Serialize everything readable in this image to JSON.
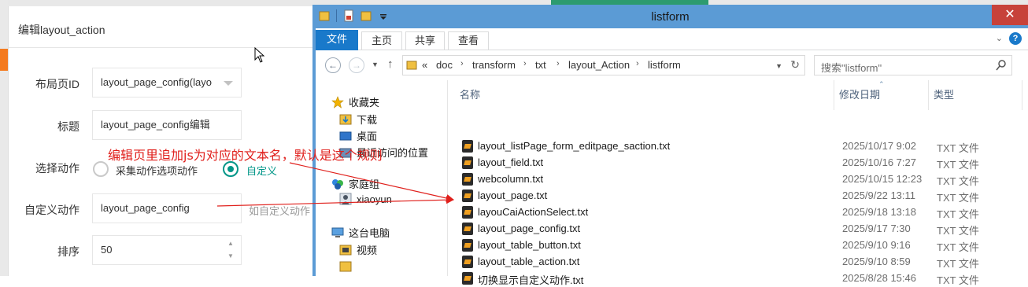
{
  "form": {
    "title": "编辑layout_action",
    "fields": [
      {
        "label": "布局页ID",
        "value": "layout_page_config(layo"
      },
      {
        "label": "标题",
        "value": "layout_page_config编辑"
      },
      {
        "label": "选择动作",
        "options": [
          "采集动作选项动作",
          "自定义"
        ],
        "selected": "自定义"
      },
      {
        "label": "自定义动作",
        "value": "layout_page_config",
        "hint": "如自定义动作"
      },
      {
        "label": "排序",
        "value": "50"
      }
    ]
  },
  "explorer": {
    "window_title": "listform",
    "ribbon_tabs": [
      "文件",
      "主页",
      "共享",
      "查看"
    ],
    "address": {
      "overflow": "«",
      "crumbs": [
        "doc",
        "transform",
        "txt",
        "layout_Action",
        "listform"
      ]
    },
    "search_placeholder": "搜索\"listform\"",
    "nav_pane": {
      "favorites": "收藏夹",
      "downloads": "下载",
      "desktop": "桌面",
      "recent": "最近访问的位置",
      "homegroup": "家庭组",
      "user": "xiaoyun",
      "this_pc": "这台电脑",
      "videos": "视频"
    },
    "columns": {
      "name": "名称",
      "date": "修改日期",
      "type": "类型"
    },
    "files": [
      {
        "name": "layout_listPage_form_editpage_saction.txt",
        "date": "2025/10/17 9:02",
        "type": "TXT 文件"
      },
      {
        "name": "layout_field.txt",
        "date": "2025/10/16 7:27",
        "type": "TXT 文件"
      },
      {
        "name": "webcolumn.txt",
        "date": "2025/10/15 12:23",
        "type": "TXT 文件"
      },
      {
        "name": "layout_page.txt",
        "date": "2025/9/22 13:11",
        "type": "TXT 文件"
      },
      {
        "name": "layouCaiActionSelect.txt",
        "date": "2025/9/18 13:18",
        "type": "TXT 文件"
      },
      {
        "name": "layout_page_config.txt",
        "date": "2025/9/17 7:30",
        "type": "TXT 文件"
      },
      {
        "name": "layout_table_button.txt",
        "date": "2025/9/10 9:16",
        "type": "TXT 文件"
      },
      {
        "name": "layout_table_action.txt",
        "date": "2025/9/10 8:59",
        "type": "TXT 文件"
      },
      {
        "name": "切换显示自定义动作.txt",
        "date": "2025/8/28 15:46",
        "type": "TXT 文件"
      }
    ]
  },
  "annotation": {
    "text": "编辑页里追加js为对应的文本名，默认是这个规则",
    "color": "#e0201c"
  },
  "colors": {
    "accent_teal": "#009688",
    "explorer_blue": "#5b9bd5",
    "file_tab_blue": "#1979ca",
    "close_red": "#c7423a"
  }
}
